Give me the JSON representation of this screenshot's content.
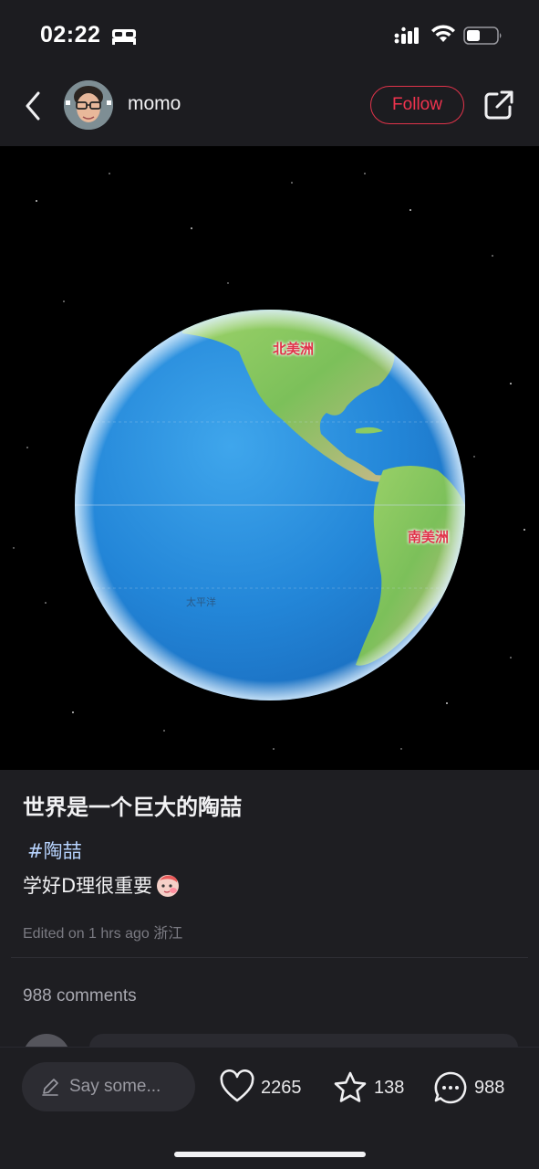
{
  "status": {
    "time": "02:22"
  },
  "header": {
    "username": "momo",
    "follow_label": "Follow"
  },
  "image": {
    "labels": {
      "north_america": "北美洲",
      "south_america": "南美洲",
      "pacific": "太平洋"
    }
  },
  "post": {
    "title": "世界是一个巨大的陶喆",
    "hashtag": "#陶喆",
    "text": "学好D理很重要",
    "meta": "Edited on 1 hrs ago 浙江"
  },
  "comments": {
    "count_label": "988 comments"
  },
  "bottom_bar": {
    "input_placeholder": "Say some...",
    "likes": "2265",
    "favorites": "138",
    "comments": "988"
  },
  "icons": {
    "back": "chevron-left-icon",
    "share": "share-icon",
    "like": "heart-icon",
    "favorite": "star-icon",
    "comment": "comment-bubble-icon",
    "edit": "pencil-icon"
  },
  "colors": {
    "accent": "#f0334e",
    "background": "#1e1e22"
  }
}
